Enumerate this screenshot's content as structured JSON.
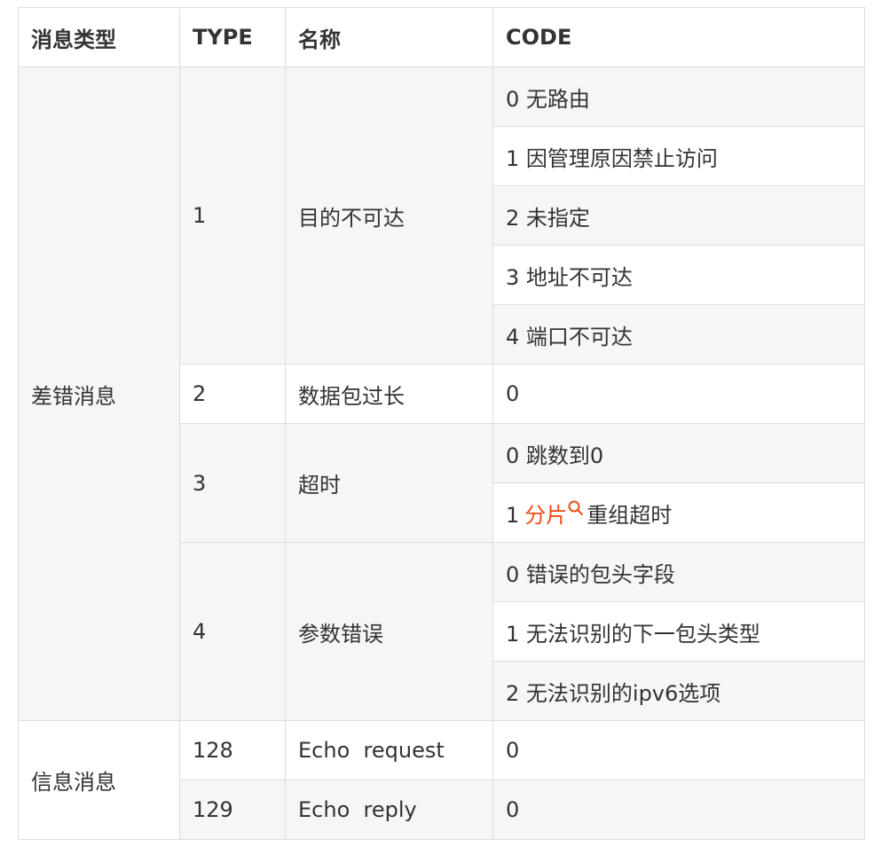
{
  "table": {
    "headers": [
      "消息类型",
      "TYPE",
      "名称",
      "CODE"
    ],
    "groups": {
      "error": "差错消息",
      "info": "信息消息"
    },
    "rows": {
      "type1": {
        "type": "1",
        "name": "目的不可达"
      },
      "type2": {
        "type": "2",
        "name": "数据包过长"
      },
      "type3": {
        "type": "3",
        "name": "超时"
      },
      "type4": {
        "type": "4",
        "name": "参数错误"
      },
      "type128": {
        "type": "128",
        "name": "Echo  request"
      },
      "type129": {
        "type": "129",
        "name": "Echo  reply"
      }
    },
    "codes": {
      "t1_0": "0 无路由",
      "t1_1": "1 因管理原因禁止访问",
      "t1_2": "2 未指定",
      "t1_3": "3 地址不可达",
      "t1_4": "4 端口不可达",
      "t2_0": "0",
      "t3_0": "0 跳数到0",
      "t3_1_prefix": "1",
      "t3_1_link": "分片",
      "t3_1_suffix": "重组超时",
      "t4_0": "0 错误的包头字段",
      "t4_1": "1 无法识别的下一包头类型",
      "t4_2": "2 无法识别的ipv6选项",
      "t128_0": "0",
      "t129_0": "0"
    }
  },
  "colors": {
    "link": "#f24a17",
    "cell_gray": "#f6f6f6",
    "border": "#dddddd",
    "text": "#333333"
  },
  "icons": {
    "link_suffix": "search-icon"
  }
}
